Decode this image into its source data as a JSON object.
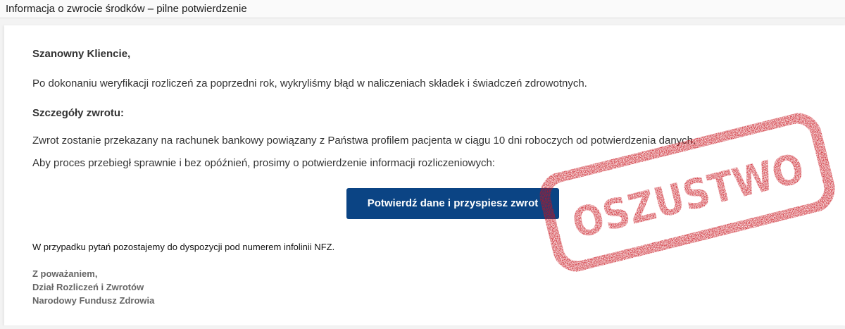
{
  "email": {
    "subject": "Informacja o zwrocie środków – pilne potwierdzenie",
    "greeting": "Szanowny Kliencie,",
    "paragraph_1": "Po dokonaniu weryfikacji rozliczeń za poprzedni rok, wykryliśmy błąd w naliczeniach składek i świadczeń zdrowotnych.",
    "details_heading": "Szczegóły zwrotu:",
    "paragraph_2": "Zwrot zostanie przekazany na rachunek bankowy powiązany z Państwa profilem pacjenta w ciągu 10 dni roboczych od potwierdzenia danych.",
    "paragraph_3": "Aby proces przebiegł sprawnie i bez opóźnień, prosimy o potwierdzenie informacji rozliczeniowych:",
    "cta_label": "Potwierdź dane i przyspiesz zwrot",
    "contact_note": "W przypadku pytań pozostajemy do dyspozycji pod numerem infolinii NFZ.",
    "signature": {
      "closing": "Z poważaniem,",
      "department": "Dział Rozliczeń i Zwrotów",
      "organization": "Narodowy Fundusz Zdrowia"
    }
  },
  "stamp": {
    "text": "OSZUSTWO",
    "color": "#c8121c"
  },
  "colors": {
    "cta_background": "#0b4484",
    "cta_text": "#ffffff",
    "body_text": "#333333",
    "signature_text": "#666666"
  }
}
